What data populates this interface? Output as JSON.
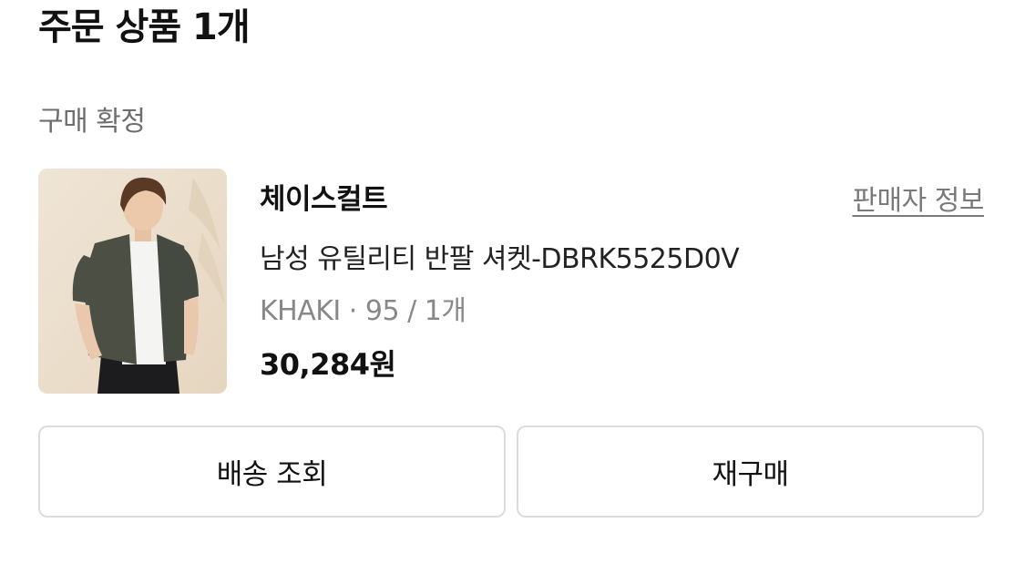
{
  "section": {
    "title": "주문 상품 1개"
  },
  "order": {
    "status": "구매 확정"
  },
  "product": {
    "brand": "체이스컬트",
    "seller_link_label": "판매자 정보",
    "name": "남성 유틸리티 반팔 셔켓-DBRK5525D0V",
    "option": "KHAKI · 95 / 1개",
    "price": "30,284원"
  },
  "actions": {
    "track_label": "배송 조회",
    "rebuy_label": "재구매"
  }
}
